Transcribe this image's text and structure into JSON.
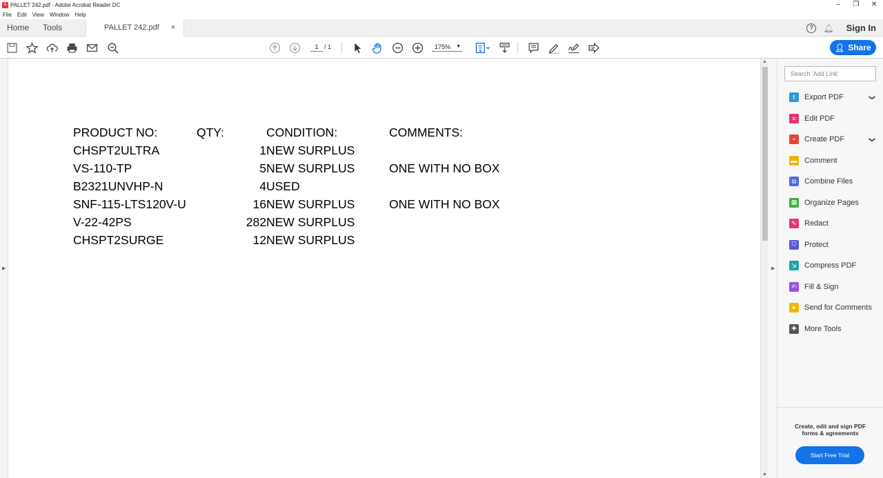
{
  "window": {
    "title": "PALLET 242.pdf - Adobe Acrobat Reader DC",
    "minimize": "–",
    "maximize": "❐",
    "close": "✕"
  },
  "menu": [
    "File",
    "Edit",
    "View",
    "Window",
    "Help"
  ],
  "tabs": {
    "home": "Home",
    "tools": "Tools",
    "document": "PALLET 242.pdf",
    "close": "×",
    "sign_in": "Sign In"
  },
  "toolbar": {
    "page_current": "1",
    "page_total": "/ 1",
    "zoom": "175%",
    "share_label": "Share"
  },
  "document": {
    "headers": {
      "product": "PRODUCT NO:",
      "qty": "QTY:",
      "condition": "CONDITION:",
      "comments": "COMMENTS:"
    },
    "rows": [
      {
        "product": "CHSPT2ULTRA",
        "qty": "1",
        "condition": "NEW SURPLUS",
        "comments": ""
      },
      {
        "product": "VS-110-TP",
        "qty": "5",
        "condition": "NEW SURPLUS",
        "comments": "ONE WITH NO BOX"
      },
      {
        "product": "B2321UNVHP-N",
        "qty": "4",
        "condition": "USED",
        "comments": ""
      },
      {
        "product": "SNF-115-LTS120V-U",
        "qty": "16",
        "condition": "NEW SURPLUS",
        "comments": "ONE WITH NO BOX"
      },
      {
        "product": "V-22-42PS",
        "qty": "282",
        "condition": "NEW SURPLUS",
        "comments": ""
      },
      {
        "product": "CHSPT2SURGE",
        "qty": "12",
        "condition": "NEW SURPLUS",
        "comments": ""
      }
    ]
  },
  "panel": {
    "search_placeholder": "Search 'Add Link'",
    "tools": [
      {
        "label": "Export PDF",
        "icon": "export-pdf-icon",
        "color": "#2d9bd8",
        "expand": true
      },
      {
        "label": "Edit PDF",
        "icon": "edit-pdf-icon",
        "color": "#e6356f",
        "expand": false
      },
      {
        "label": "Create PDF",
        "icon": "create-pdf-icon",
        "color": "#e8443a",
        "expand": true
      },
      {
        "label": "Comment",
        "icon": "comment-icon",
        "color": "#f3b500",
        "expand": false
      },
      {
        "label": "Combine Files",
        "icon": "combine-files-icon",
        "color": "#4f6ce8",
        "expand": false
      },
      {
        "label": "Organize Pages",
        "icon": "organize-pages-icon",
        "color": "#3cb043",
        "expand": false
      },
      {
        "label": "Redact",
        "icon": "redact-icon",
        "color": "#e6356f",
        "expand": false
      },
      {
        "label": "Protect",
        "icon": "protect-icon",
        "color": "#5a5ad6",
        "expand": false
      },
      {
        "label": "Compress PDF",
        "icon": "compress-pdf-icon",
        "color": "#1aa3a8",
        "expand": false
      },
      {
        "label": "Fill & Sign",
        "icon": "fill-sign-icon",
        "color": "#9a4fe0",
        "expand": false
      },
      {
        "label": "Send for Comments",
        "icon": "send-for-comments-icon",
        "color": "#f3b500",
        "expand": false
      },
      {
        "label": "More Tools",
        "icon": "more-tools-icon",
        "color": "#555555",
        "expand": false
      }
    ],
    "promo_text": "Create, edit and sign PDF forms & agreements",
    "trial_label": "Start Free Trial"
  },
  "colors": {
    "accent": "#1473e6"
  }
}
